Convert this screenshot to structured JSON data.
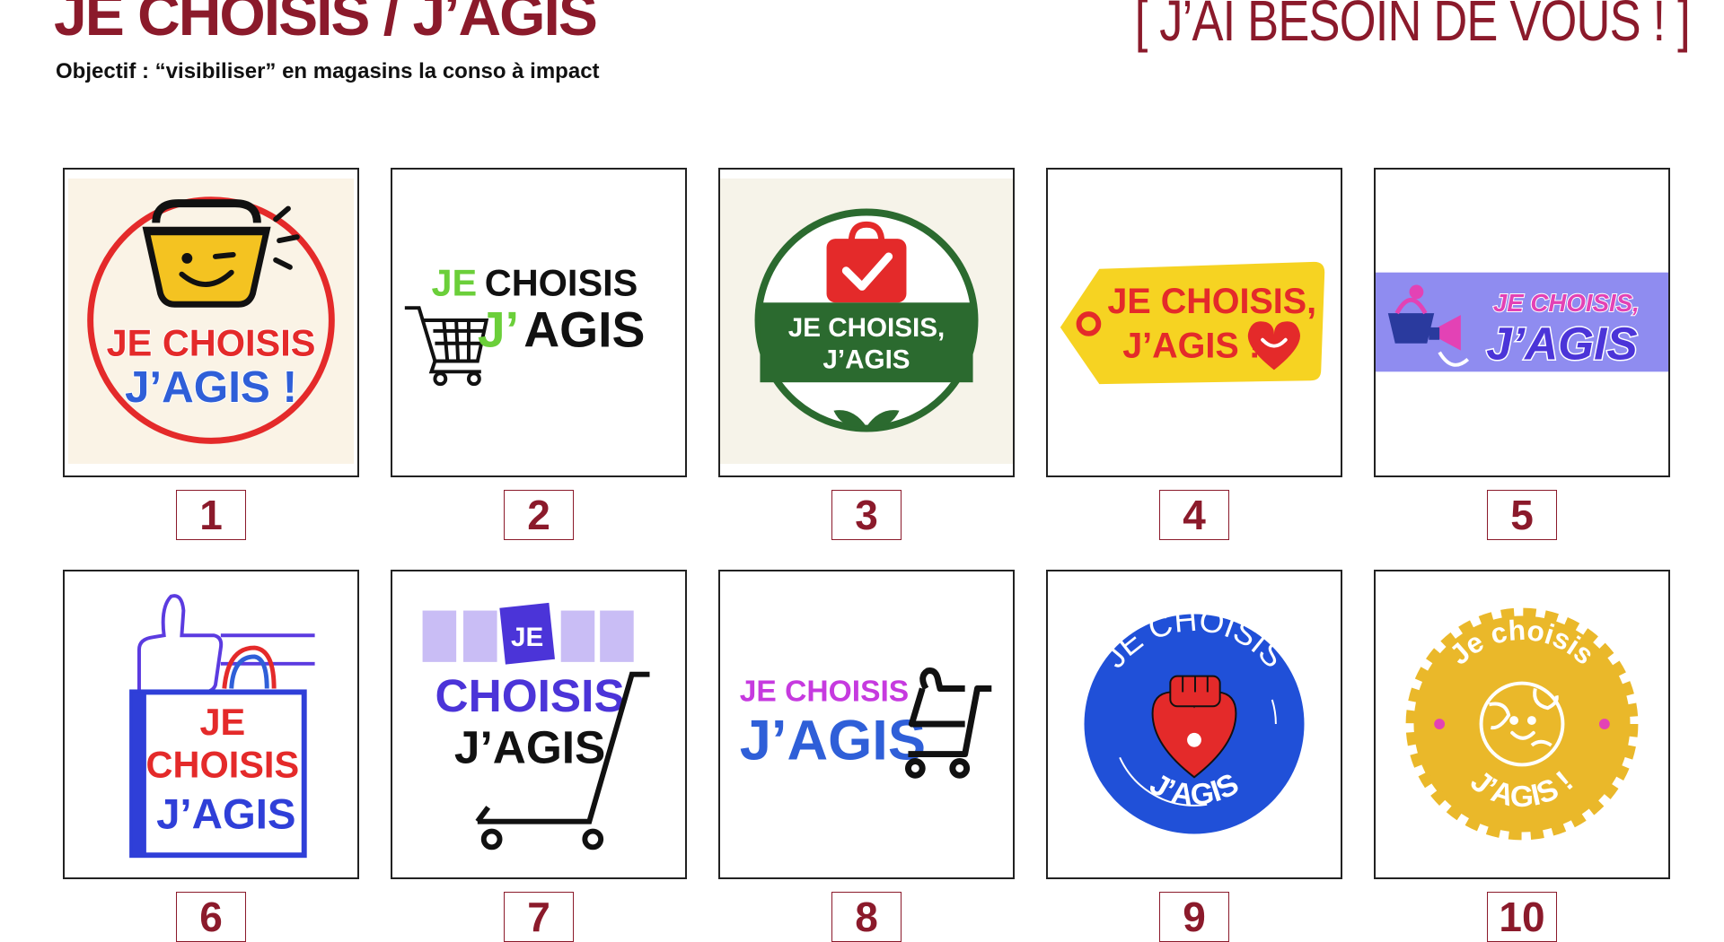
{
  "header": {
    "title": "JE CHOISIS / J’AGIS",
    "subtitle": "Objectif : “visibiliser” en magasins la conso à impact",
    "callout": "[ J’AI BESOIN DE VOUS ! ]"
  },
  "proposals": [
    {
      "number": "1",
      "texts": [
        "JE CHOISIS",
        "J’AGIS !"
      ]
    },
    {
      "number": "2",
      "texts": [
        "JE",
        "CHOISIS",
        "J’",
        "AGIS"
      ]
    },
    {
      "number": "3",
      "texts": [
        "JE CHOISIS,",
        "J’AGIS"
      ]
    },
    {
      "number": "4",
      "texts": [
        "JE CHOISIS,",
        "J’AGIS !"
      ]
    },
    {
      "number": "5",
      "texts": [
        "JE CHOISIS,",
        "J’AGIS"
      ]
    },
    {
      "number": "6",
      "texts": [
        "JE",
        "CHOISIS",
        "J’AGIS"
      ]
    },
    {
      "number": "7",
      "texts": [
        "JE",
        "CHOISIS",
        "J’AGIS"
      ]
    },
    {
      "number": "8",
      "texts": [
        "JE CHOISIS",
        "J’AGIS"
      ]
    },
    {
      "number": "9",
      "texts": [
        "JE CHOISIS",
        "J’AGIS"
      ]
    },
    {
      "number": "10",
      "texts": [
        "Je choisis",
        "J’AGIS !"
      ]
    }
  ],
  "colors": {
    "brand": "#8b1a2b",
    "red": "#e42a2a",
    "blue": "#2f5fd8",
    "green": "#2b6a2f",
    "lightgreen": "#6bcf3a",
    "yellow": "#f6d322",
    "purple": "#5b3be0",
    "magenta": "#c63adf",
    "gold": "#eab82a"
  },
  "icons": [
    "shopping-basket-icon",
    "shopping-cart-icon",
    "shopping-bag-check-icon",
    "price-tag-icon",
    "megaphone-icon",
    "thumbs-up-icon",
    "fist-heart-icon",
    "globe-smile-icon"
  ]
}
